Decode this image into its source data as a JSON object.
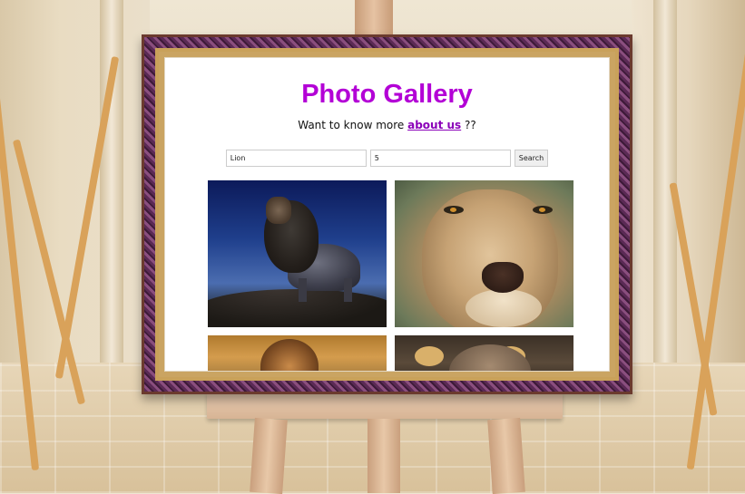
{
  "gallery": {
    "title": "Photo Gallery",
    "subtitle_prefix": "Want to know more ",
    "subtitle_link": "about us",
    "subtitle_suffix": " ??",
    "search": {
      "query_value": "Lion",
      "count_value": "5",
      "button_label": "Search"
    },
    "photos": [
      {
        "subject": "lion roaring at dusk"
      },
      {
        "subject": "lion face close-up"
      },
      {
        "subject": "lion lying down"
      },
      {
        "subject": "lion cub peeking"
      }
    ]
  },
  "colors": {
    "title": "#b300d6",
    "link": "#8a00b8",
    "frame": "#5b2a55",
    "frame_gold": "#c9a15a"
  }
}
